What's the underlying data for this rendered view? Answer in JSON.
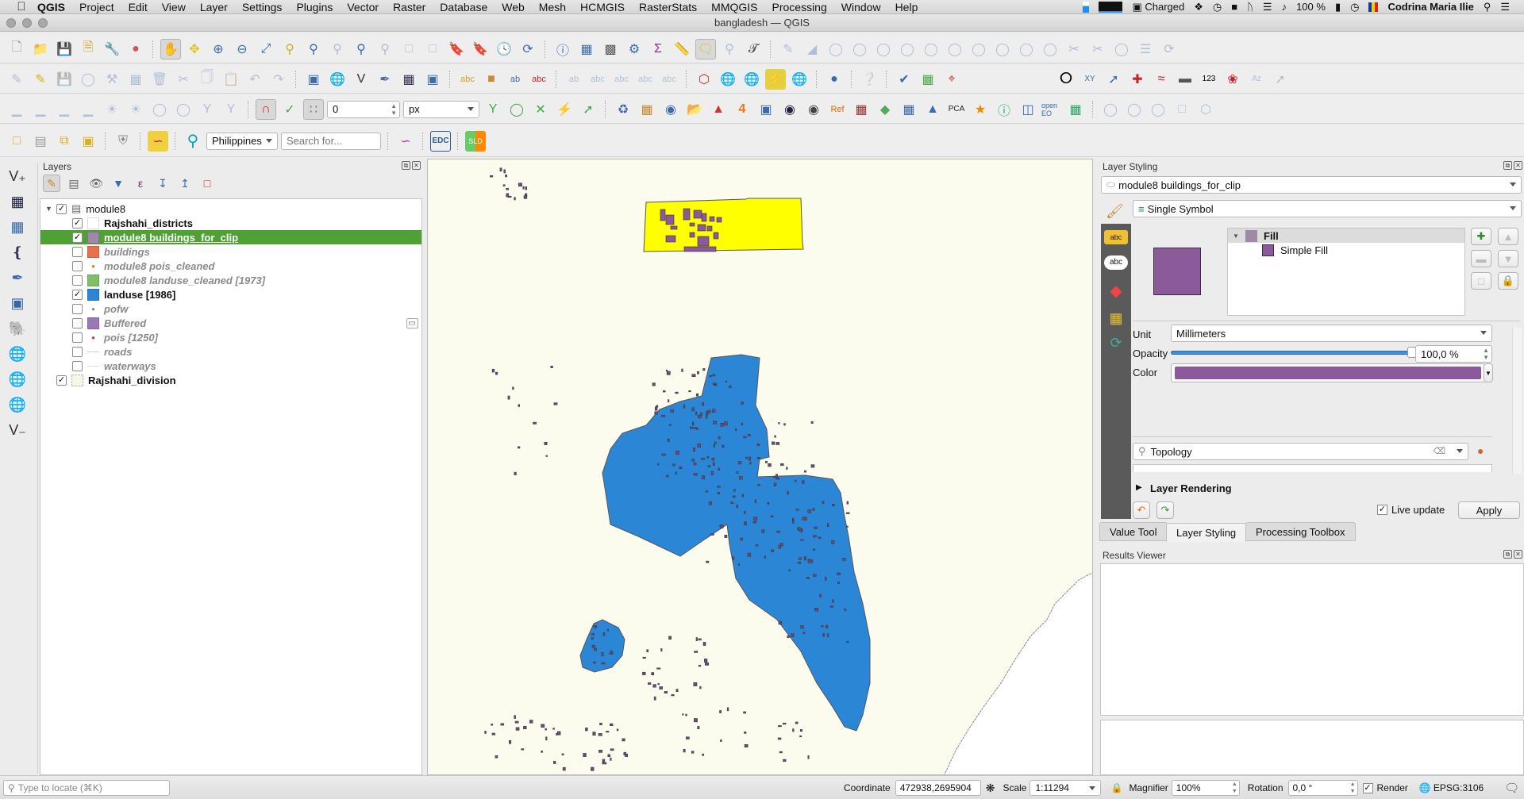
{
  "menubar": {
    "app": "QGIS",
    "items": [
      "Project",
      "Edit",
      "View",
      "Layer",
      "Settings",
      "Plugins",
      "Vector",
      "Raster",
      "Database",
      "Web",
      "Mesh",
      "HCMGIS",
      "RasterStats",
      "MMQGIS",
      "Processing",
      "Window",
      "Help"
    ],
    "battery_status": "Charged",
    "battery_percent": "100 %",
    "user": "Codrina Maria Ilie"
  },
  "window": {
    "title": "bangladesh — QGIS"
  },
  "toolbar": {
    "snapping_tolerance": "0",
    "snapping_unit": "px",
    "locator_country": "Philippines",
    "search_placeholder": "Search for...",
    "edc_label": "EDC"
  },
  "layers_panel": {
    "title": "Layers",
    "group": {
      "name": "module8",
      "checked": true
    },
    "items": [
      {
        "name": "Rajshahi_districts",
        "checked": true,
        "style": "bold",
        "swatch": "#ffffff",
        "kind": "fill"
      },
      {
        "name": "module8 buildings_for_clip",
        "checked": true,
        "style": "selected",
        "swatch": "#a088a8",
        "kind": "fill"
      },
      {
        "name": "buildings",
        "checked": false,
        "style": "off",
        "swatch": "#e8704a",
        "kind": "fill"
      },
      {
        "name": "module8 pois_cleaned",
        "checked": false,
        "style": "off",
        "swatch": "#b08a40",
        "kind": "point"
      },
      {
        "name": "module8 landuse_cleaned [1973]",
        "checked": false,
        "style": "off",
        "swatch": "#7fbf6a",
        "kind": "fill"
      },
      {
        "name": "landuse [1986]",
        "checked": true,
        "style": "bold",
        "swatch": "#2a86d8",
        "kind": "fill"
      },
      {
        "name": "pofw",
        "checked": false,
        "style": "off",
        "swatch": "#a08060",
        "kind": "point"
      },
      {
        "name": "Buffered",
        "checked": false,
        "style": "off",
        "swatch": "#9a78b8",
        "kind": "fill"
      },
      {
        "name": "pois [1250]",
        "checked": false,
        "style": "off",
        "swatch": "#b04060",
        "kind": "point"
      },
      {
        "name": "roads",
        "checked": false,
        "style": "off",
        "swatch": "#e0c8d8",
        "kind": "line"
      },
      {
        "name": "waterways",
        "checked": false,
        "style": "off",
        "swatch": "#f0d0e0",
        "kind": "line"
      }
    ],
    "root_item": {
      "name": "Rajshahi_division",
      "checked": true,
      "swatch": "#f7f7e6"
    }
  },
  "layer_styling": {
    "title": "Layer Styling",
    "layer": "module8 buildings_for_clip",
    "renderer": "Single Symbol",
    "symbol_tree": {
      "root": "Fill",
      "child": "Simple Fill"
    },
    "unit_label": "Unit",
    "unit_value": "Millimeters",
    "opacity_label": "Opacity",
    "opacity_value": "100,0 %",
    "opacity_fraction": 1.0,
    "color_label": "Color",
    "fill_color": "#8a5a9a",
    "search_value": "Topology",
    "layer_rendering": "Layer Rendering",
    "live_update": "Live update",
    "live_update_checked": true,
    "apply": "Apply"
  },
  "tabs": [
    {
      "label": "Value Tool",
      "active": false
    },
    {
      "label": "Layer Styling",
      "active": true
    },
    {
      "label": "Processing Toolbox",
      "active": false
    }
  ],
  "results_viewer": {
    "title": "Results Viewer"
  },
  "statusbar": {
    "locate_placeholder": "Type to locate (⌘K)",
    "coordinate_label": "Coordinate",
    "coordinate_value": "472938,2695904",
    "scale_label": "Scale",
    "scale_value": "1:11294",
    "magnifier_label": "Magnifier",
    "magnifier_value": "100%",
    "rotation_label": "Rotation",
    "rotation_value": "0,0 °",
    "render_label": "Render",
    "render_checked": true,
    "crs": "EPSG:3106"
  },
  "colors": {
    "selection_green": "#4fa133",
    "landuse_blue": "#2b87d6",
    "district_yellow": "#ffff00",
    "building_purple": "#8a5a9a",
    "map_background": "#fbfbee"
  }
}
